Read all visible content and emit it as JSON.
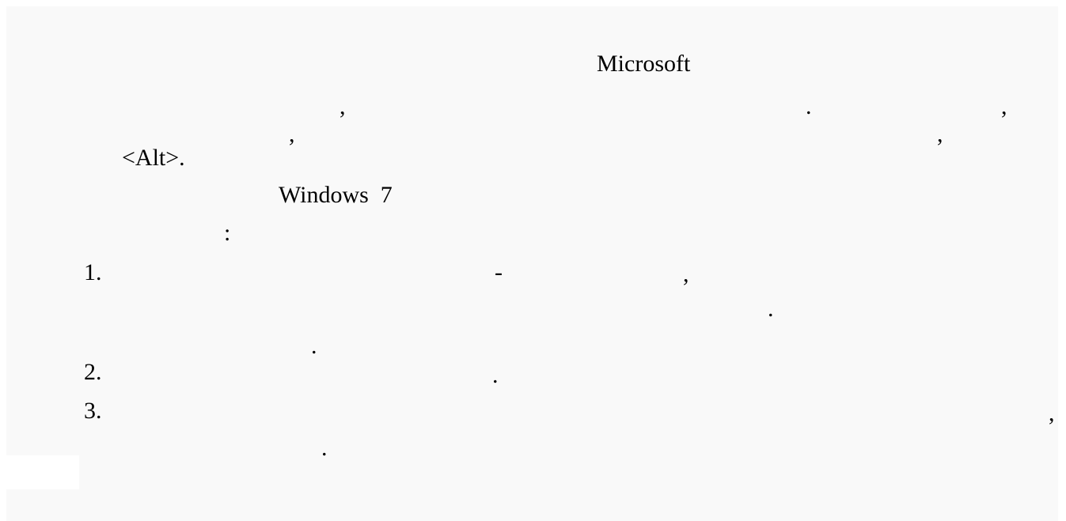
{
  "document": {
    "word_microsoft": "Microsoft",
    "line2_comma1": ",",
    "line2_period": ".",
    "line2_comma2": ",",
    "line3_comma1": ",",
    "line3_comma2": ",",
    "alt_key": "<Alt>.",
    "windows_version": "Windows  7",
    "colon": ":",
    "list": {
      "item1_number": "1.",
      "item1_dash": "-",
      "item1_comma": ",",
      "item1_period1": ".",
      "item1_period2": ".",
      "item2_number": "2.",
      "item2_period": ".",
      "item3_number": "3.",
      "item3_comma": ",",
      "item3_period": "."
    }
  }
}
